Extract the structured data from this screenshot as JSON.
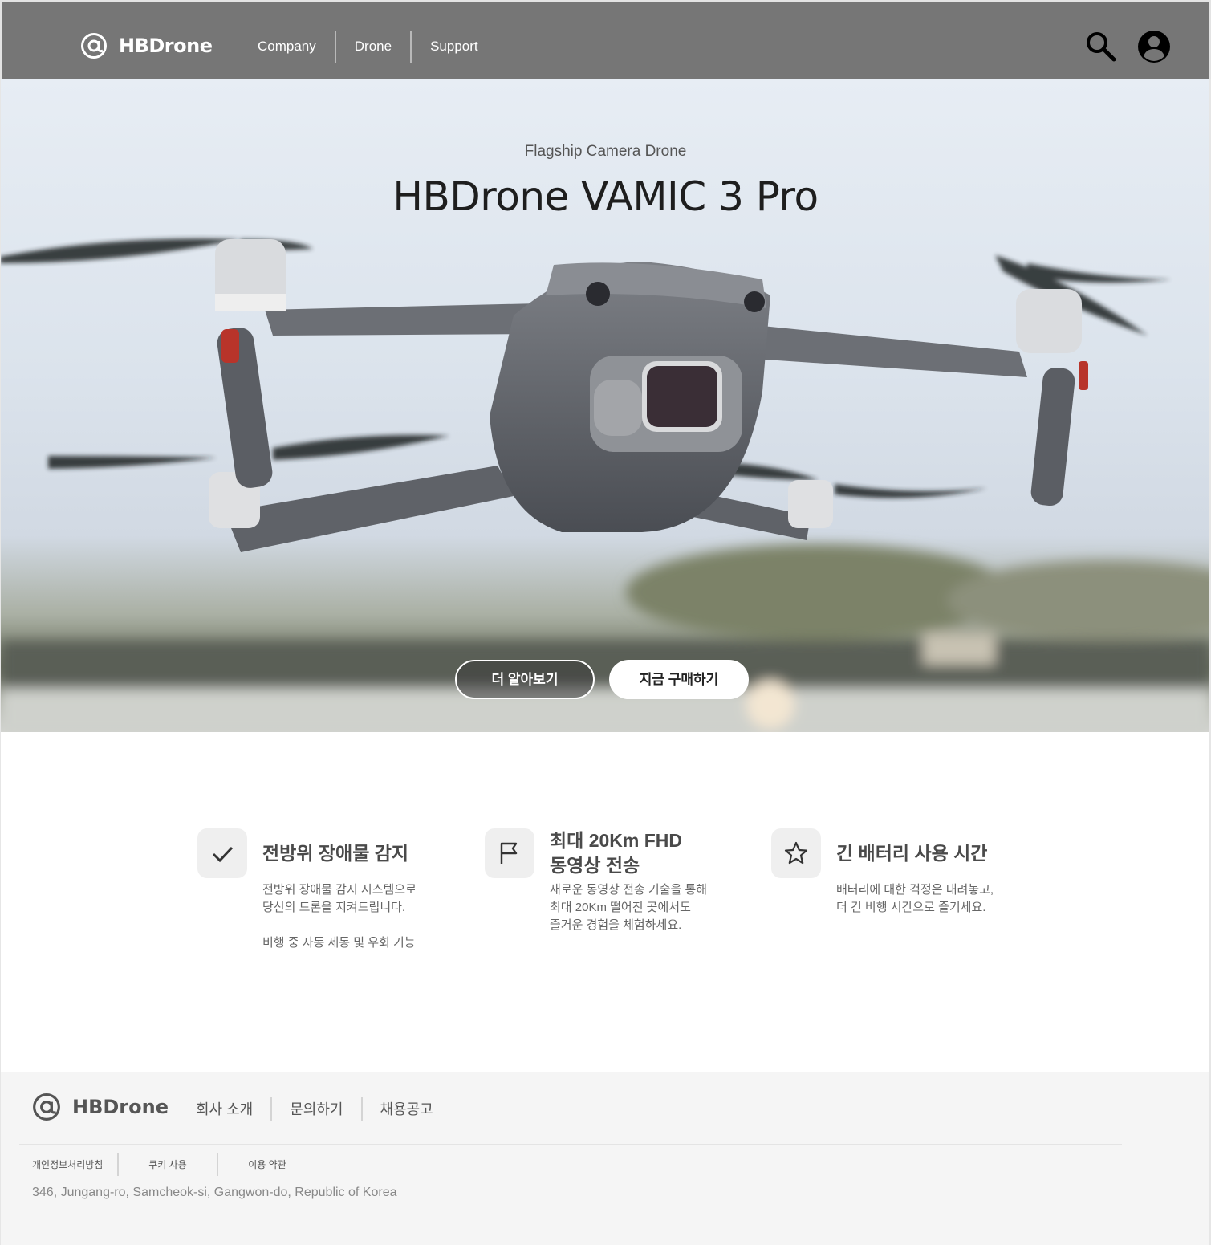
{
  "header": {
    "logo_text": "HBDrone",
    "nav": [
      "Company",
      "Drone",
      "Support"
    ],
    "icons": [
      "search-icon",
      "account-icon"
    ],
    "bg_color": "#767676"
  },
  "hero": {
    "subtitle": "Flagship Camera Drone",
    "title": "HBDrone VAMIC 3 Pro",
    "btn_learn": "더 알아보기",
    "btn_buy": "지금 구매하기"
  },
  "features": [
    {
      "icon": "check-icon",
      "title_lines": [
        "전방위 장애물 감지"
      ],
      "desc_lines": [
        "전방위 장애물 감지 시스템으로",
        "당신의 드론을 지켜드립니다."
      ],
      "extra_line": "비행 중 자동 제동 및 우회 기능"
    },
    {
      "icon": "flag-icon",
      "title_lines": [
        "최대 20Km FHD",
        "동영상 전송"
      ],
      "desc_lines": [
        "새로운 동영상 전송 기술을 통해",
        "최대 20Km 떨어진 곳에서도",
        "즐거운 경험을 체험하세요."
      ]
    },
    {
      "icon": "star-icon",
      "title_lines": [
        "긴 배터리 사용 시간"
      ],
      "desc_lines": [
        "배터리에 대한 걱정은 내려놓고,",
        "더 긴 비행 시간으로 즐기세요."
      ]
    }
  ],
  "footer": {
    "logo_text": "HBDrone",
    "nav": [
      "회사 소개",
      "문의하기",
      "채용공고"
    ],
    "links": [
      "개인정보처리방침",
      "쿠키 사용",
      "이용 약관"
    ],
    "address": "346, Jungang-ro, Samcheok-si, Gangwon-do, Republic of Korea",
    "bg_color": "#f5f5f5"
  }
}
